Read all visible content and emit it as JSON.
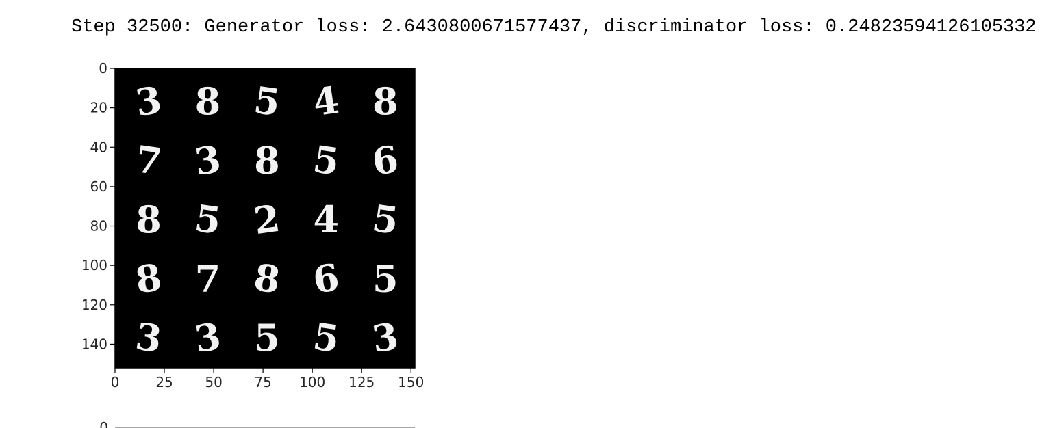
{
  "output": {
    "log_line": "Step 32500: Generator loss: 2.6430800671577437, discriminator loss: 0.24823594126105332"
  },
  "figure": {
    "x_ticks": [
      "0",
      "25",
      "50",
      "75",
      "100",
      "125",
      "150"
    ],
    "y_ticks": [
      "0",
      "20",
      "40",
      "60",
      "80",
      "100",
      "120",
      "140"
    ],
    "next_figure_first_tick": "0",
    "grid_digits": [
      [
        "3",
        "8",
        "5",
        "4",
        "8"
      ],
      [
        "7",
        "3",
        "8",
        "5",
        "6"
      ],
      [
        "8",
        "5",
        "2",
        "4",
        "5"
      ],
      [
        "8",
        "7",
        "8",
        "6",
        "5"
      ],
      [
        "3",
        "3",
        "5",
        "5",
        "3"
      ]
    ]
  },
  "chart_data": {
    "type": "heatmap",
    "title": "",
    "xlabel": "",
    "ylabel": "",
    "xlim": [
      0,
      152
    ],
    "ylim": [
      152,
      0
    ],
    "x_ticks": [
      0,
      25,
      50,
      75,
      100,
      125,
      150
    ],
    "y_ticks": [
      0,
      20,
      40,
      60,
      80,
      100,
      120,
      140
    ],
    "grid": false,
    "colormap": "gray",
    "colors": {
      "background": "#000000",
      "foreground": "#f2f2f2",
      "tick_text": "#262626"
    }
  }
}
